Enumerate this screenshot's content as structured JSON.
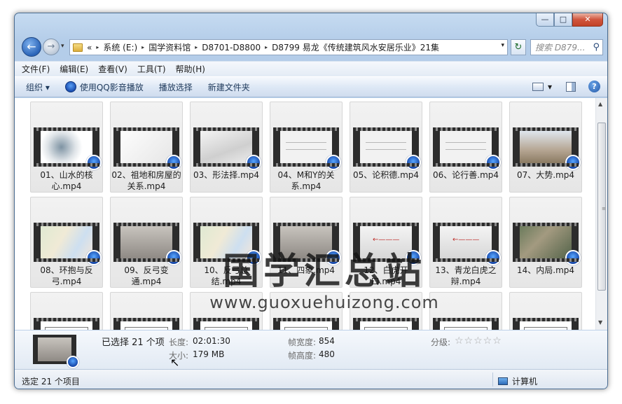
{
  "window": {
    "min_label": "—",
    "max_label": "□",
    "close_label": "✕"
  },
  "nav": {
    "back_glyph": "←",
    "forward_glyph": "→",
    "recent_glyph": "▾"
  },
  "address": {
    "prefix": "«",
    "crumbs": [
      "系统 (E:)",
      "国学资料馆",
      "D8701-D8800",
      "D8799 易龙《传统建筑风水安居乐业》21集"
    ],
    "separator": "▸",
    "dropdown": "▾",
    "refresh": "↻"
  },
  "search": {
    "placeholder": "搜索 D879...",
    "icon": "⚲"
  },
  "menu": [
    "文件(F)",
    "编辑(E)",
    "查看(V)",
    "工具(T)",
    "帮助(H)"
  ],
  "commands": {
    "organize": "组织 ▾",
    "qq_play": "使用QQ影音播放",
    "play_selection": "播放选择",
    "new_folder": "新建文件夹",
    "view_drop": "▾",
    "help": "?"
  },
  "files": [
    {
      "label": "01、山水的核心.mp4",
      "frame": "swirl"
    },
    {
      "label": "02、祖地和房屋的关系.mp4",
      "frame": "white"
    },
    {
      "label": "03、形法择.mp4",
      "frame": "grey"
    },
    {
      "label": "04、M和Y的关系.mp4",
      "frame": "paper"
    },
    {
      "label": "05、论积德.mp4",
      "frame": "paper"
    },
    {
      "label": "06、论行善.mp4",
      "frame": "paper"
    },
    {
      "label": "07、大势.mp4",
      "frame": "city"
    },
    {
      "label": "08、环抱与反弓.mp4",
      "frame": "map"
    },
    {
      "label": "09、反弓变通.mp4",
      "frame": "photo"
    },
    {
      "label": "10、反弓总结.mp4",
      "frame": "map"
    },
    {
      "label": "11、四象.mp4",
      "frame": "photo"
    },
    {
      "label": "12、白虎开口.mp4",
      "frame": "arrow"
    },
    {
      "label": "13、青龙白虎之辩.mp4",
      "frame": "arrow"
    },
    {
      "label": "14、内局.mp4",
      "frame": "aerial"
    },
    {
      "label": "",
      "frame": "plan"
    },
    {
      "label": "",
      "frame": "plan"
    },
    {
      "label": "",
      "frame": "plan"
    },
    {
      "label": "",
      "frame": "plan"
    },
    {
      "label": "",
      "frame": "plan"
    },
    {
      "label": "",
      "frame": "plan"
    },
    {
      "label": "",
      "frame": "plan"
    }
  ],
  "watermark": {
    "title": "国学汇总站",
    "url": "www.guoxuehuizong.com"
  },
  "details": {
    "selected": "已选择 21 个项",
    "length_label": "长度:",
    "length_value": "02:01:30",
    "size_label": "大小:",
    "size_value": "179 MB",
    "width_label": "帧宽度:",
    "width_value": "854",
    "height_label": "帧高度:",
    "height_value": "480",
    "rating_label": "分级:",
    "rating_stars": "☆☆☆☆☆",
    "rating_value": 0
  },
  "status": {
    "left": "选定 21 个项目",
    "right": "计算机"
  },
  "scroll": {
    "up": "▲",
    "down": "▼",
    "grip": "≡"
  }
}
